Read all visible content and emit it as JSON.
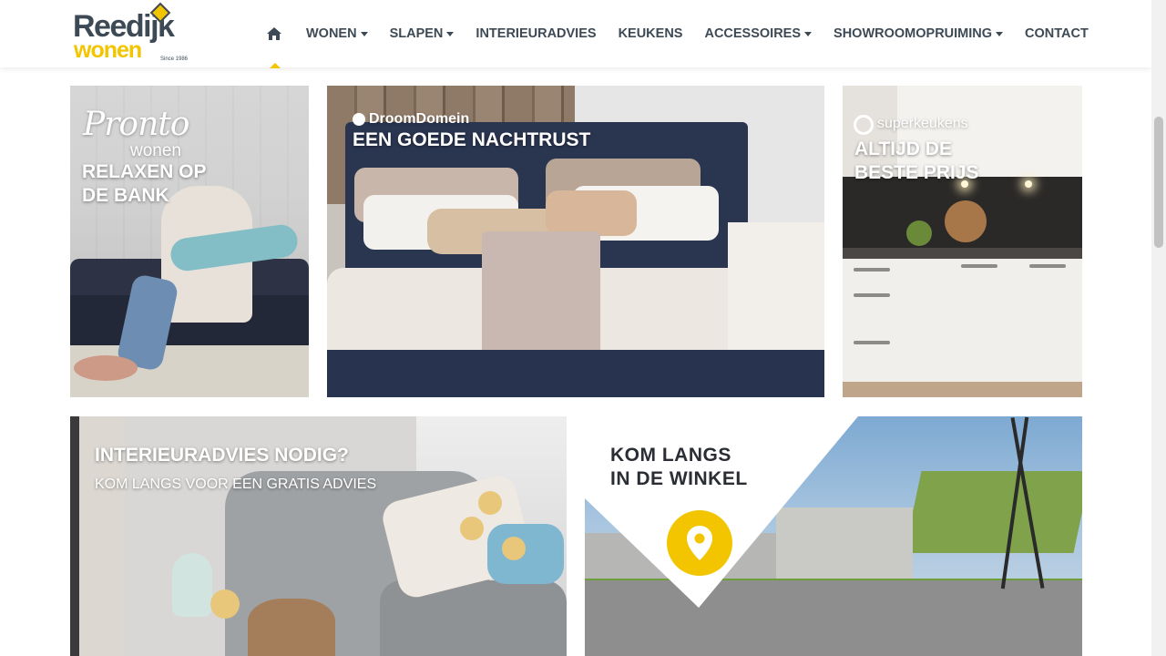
{
  "header": {
    "logo": {
      "name": "Reedijk",
      "sub": "wonen",
      "since": "Since 1986"
    },
    "nav": [
      {
        "label": "WONEN",
        "dropdown": true
      },
      {
        "label": "SLAPEN",
        "dropdown": true
      },
      {
        "label": "INTERIEURADVIES",
        "dropdown": false
      },
      {
        "label": "KEUKENS",
        "dropdown": false
      },
      {
        "label": "ACCESSOIRES",
        "dropdown": true
      },
      {
        "label": "SHOWROOMOPRUIMING",
        "dropdown": true
      },
      {
        "label": "CONTACT",
        "dropdown": false
      }
    ],
    "home_icon": "home-icon"
  },
  "tiles": {
    "pronto": {
      "brand": "Pronto",
      "brand_sub": "wonen",
      "title_line1": "RELAXEN OP",
      "title_line2": "DE BANK"
    },
    "droomdomein": {
      "brand": "DroomDomein",
      "title": "EEN GOEDE NACHTRUST"
    },
    "superkeukens": {
      "brand": "superkeukens",
      "title_line1": "ALTIJD DE",
      "title_line2": "BESTE PRIJS"
    },
    "interieuradvies": {
      "title": "INTERIEURADVIES NODIG?",
      "subtitle": "KOM LANGS VOOR EEN GRATIS ADVIES"
    },
    "winkel": {
      "title_line1": "KOM LANGS",
      "title_line2": "IN DE WINKEL",
      "icon": "location-pin-icon"
    }
  },
  "colors": {
    "accent": "#f2c500",
    "nav_text": "#3d4a55"
  }
}
